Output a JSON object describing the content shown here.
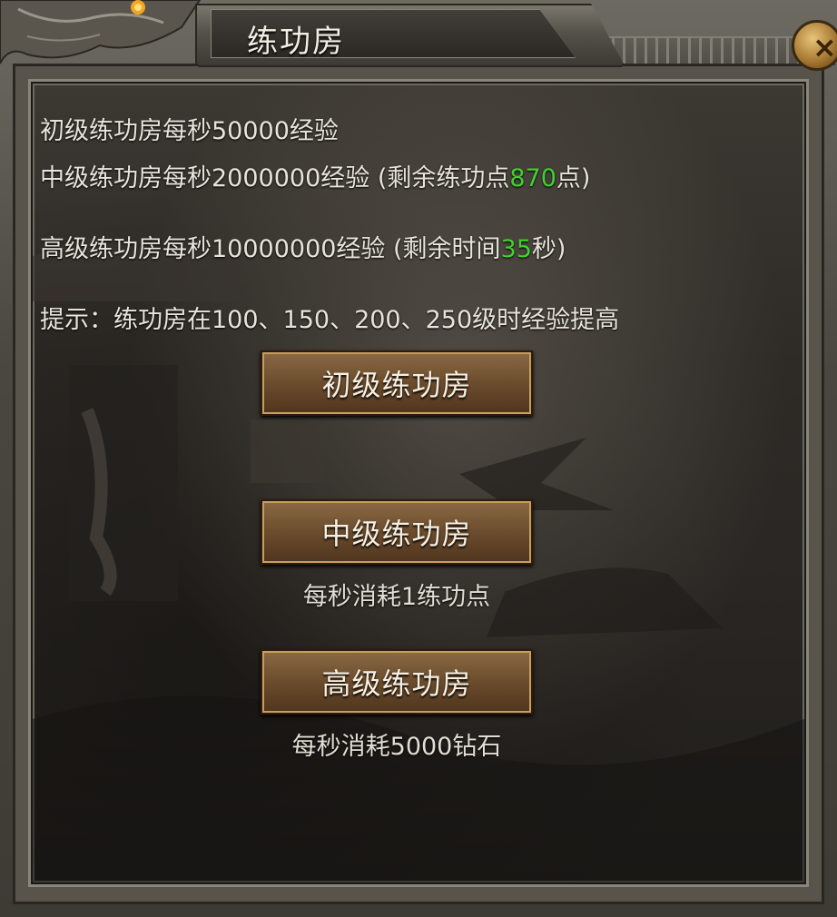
{
  "window": {
    "title": "练功房",
    "close_label": "×"
  },
  "info": {
    "line1": "初级练功房每秒50000经验",
    "line2_prefix": "中级练功房每秒2000000经验 (剩余练功点",
    "line2_value": "870",
    "line2_suffix": "点)",
    "line3_prefix": "高级练功房每秒10000000经验 (剩余时间",
    "line3_value": "35",
    "line3_suffix": "秒)",
    "tip": "提示：练功房在100、150、200、250级时经验提高"
  },
  "buttons": {
    "primary": "初级练功房",
    "intermediate": "中级练功房",
    "advanced": "高级练功房"
  },
  "costs": {
    "intermediate": "每秒消耗1练功点",
    "advanced": "每秒消耗5000钻石"
  },
  "colors": {
    "highlight": "#3fd22e",
    "button": "#6b4c2d",
    "panel": "#2e2b27"
  }
}
